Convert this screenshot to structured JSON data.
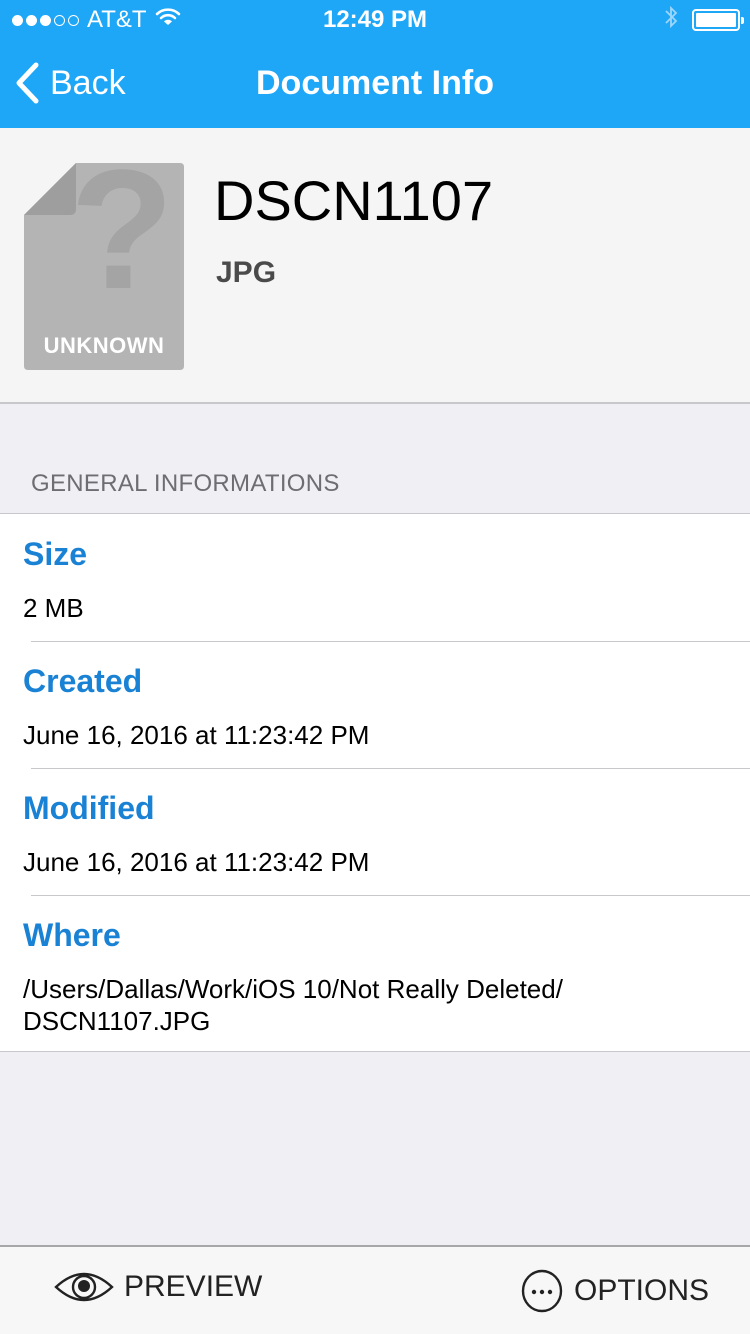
{
  "status_bar": {
    "carrier": "AT&T",
    "signal_strength": 3,
    "signal_max": 5,
    "time": "12:49 PM",
    "icons": [
      "wifi-icon",
      "bluetooth-icon",
      "battery-icon"
    ],
    "bluetooth_glyph": "∦"
  },
  "nav": {
    "back_label": "Back",
    "title": "Document Info"
  },
  "document": {
    "name": "DSCN1107",
    "type": "JPG",
    "icon_label": "UNKNOWN",
    "icon": "unknown-file-icon"
  },
  "section": {
    "title": "GENERAL INFORMATIONS"
  },
  "info": [
    {
      "label": "Size",
      "value": "2 MB"
    },
    {
      "label": "Created",
      "value": "June 16, 2016 at 11:23:42 PM"
    },
    {
      "label": "Modified",
      "value": "June 16, 2016 at 11:23:42 PM"
    },
    {
      "label": "Where",
      "value": "/Users/Dallas/Work/iOS 10/Not Really Deleted/ DSCN1107.JPG"
    }
  ],
  "toolbar": {
    "preview_label": "PREVIEW",
    "options_label": "OPTIONS"
  },
  "colors": {
    "nav_bar": "#1ea6f7",
    "label_blue": "#1a82d4",
    "background": "#efeff4"
  }
}
